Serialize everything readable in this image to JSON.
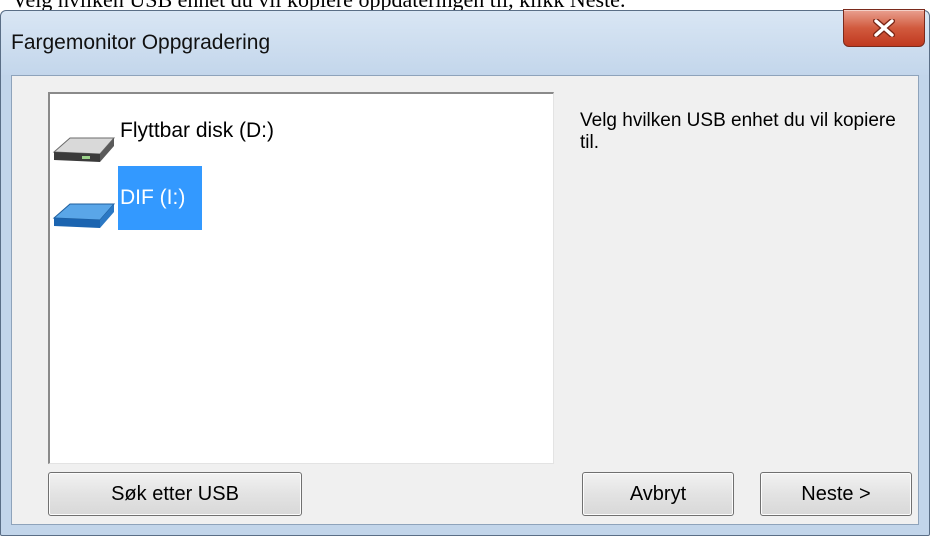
{
  "caption": "Velg hvilken USB enhet du vil kopiere oppdateringen til, klikk Neste.",
  "window": {
    "title": "Fargemonitor Oppgradering"
  },
  "devices": [
    {
      "label": "Flyttbar disk (D:)",
      "icon": "removable-disk-icon",
      "selected": false
    },
    {
      "label": "DIF (I:)",
      "icon": "usb-drive-icon",
      "selected": true
    }
  ],
  "instructions": "Velg hvilken USB enhet du vil kopiere til.",
  "buttons": {
    "scan_label": "Søk etter USB",
    "cancel_label": "Avbryt",
    "next_label": "Neste >"
  },
  "colors": {
    "selection": "#3399ff",
    "close_button": "#c94a2f",
    "title_bar": "#c2d5ea"
  }
}
